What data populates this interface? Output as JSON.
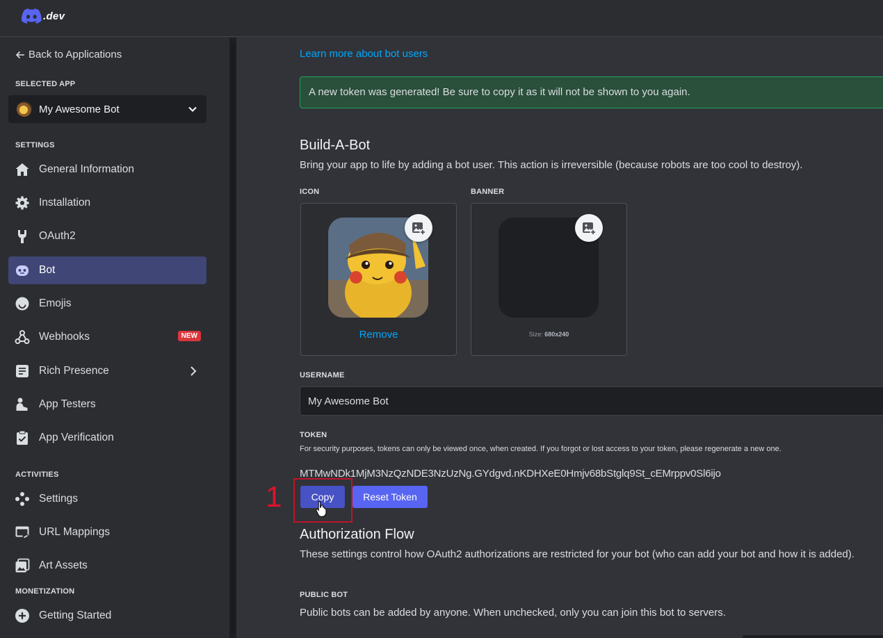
{
  "header": {
    "logo_text": ".dev"
  },
  "sidebar": {
    "back_label": "Back to Applications",
    "selected_app_section": "SELECTED APP",
    "selected_app_name": "My Awesome Bot",
    "sections": {
      "settings": "SETTINGS",
      "activities": "ACTIVITIES",
      "monetization": "MONETIZATION"
    },
    "items": [
      {
        "label": "General Information",
        "icon": "home-icon"
      },
      {
        "label": "Installation",
        "icon": "gear-icon"
      },
      {
        "label": "OAuth2",
        "icon": "wrench-icon"
      },
      {
        "label": "Bot",
        "icon": "bot-icon",
        "active": true
      },
      {
        "label": "Emojis",
        "icon": "smile-icon"
      },
      {
        "label": "Webhooks",
        "icon": "webhook-icon",
        "badge": "NEW"
      },
      {
        "label": "Rich Presence",
        "icon": "document-icon"
      },
      {
        "label": "App Testers",
        "icon": "person-icon"
      },
      {
        "label": "App Verification",
        "icon": "clipboard-check-icon"
      }
    ],
    "activity_items": [
      {
        "label": "Settings",
        "icon": "gamepad-icon"
      },
      {
        "label": "URL Mappings",
        "icon": "link-window-icon"
      },
      {
        "label": "Art Assets",
        "icon": "image-stack-icon"
      }
    ],
    "monetization_items": [
      {
        "label": "Getting Started",
        "icon": "plus-circle-icon"
      }
    ]
  },
  "main": {
    "learn_more": "Learn more about bot users",
    "alert": "A new token was generated! Be sure to copy it as it will not be shown to you again.",
    "build_title": "Build-A-Bot",
    "build_desc": "Bring your app to life by adding a bot user. This action is irreversible (because robots are too cool to destroy).",
    "icon_label": "ICON",
    "banner_label": "BANNER",
    "remove_label": "Remove",
    "size_prefix": "Size:",
    "size_value": "680x240",
    "username_label": "USERNAME",
    "username_value": "My Awesome Bot",
    "token_label": "TOKEN",
    "token_desc": "For security purposes, tokens can only be viewed once, when created. If you forgot or lost access to your token, please regenerate a new one.",
    "token_value": "MTMwNDk1MjM3NzQzNDE3NzUzNg.GYdgvd.nKDHXeE0Hmjv68bStglq9St_cEMrppv0Sl6ijo",
    "copy_label": "Copy",
    "reset_label": "Reset Token",
    "auth_title": "Authorization Flow",
    "auth_desc": "These settings control how OAuth2 authorizations are restricted for your bot (who can add your bot and how it is added).",
    "public_bot_label": "PUBLIC BOT",
    "public_bot_desc": "Public bots can be added by anyone. When unchecked, only you can join this bot to servers."
  },
  "annotation": {
    "step": "1"
  },
  "colors": {
    "accent": "#5865f2",
    "copy_button": "#4752c4",
    "link": "#00a8fc",
    "success_border": "#23a55a",
    "badge_red": "#da373c",
    "annotation_red": "#e0122b"
  }
}
